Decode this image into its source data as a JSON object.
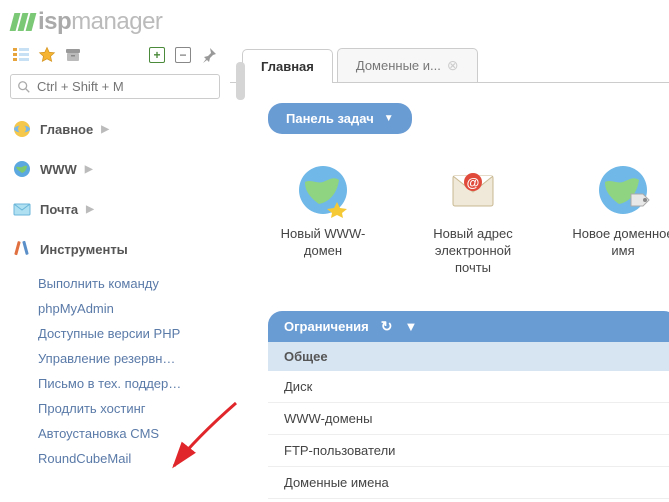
{
  "logo": {
    "bold": "isp",
    "light": "manager"
  },
  "search": {
    "placeholder": "Ctrl + Shift + M"
  },
  "nav": {
    "main": "Главное",
    "www": "WWW",
    "mail": "Почта",
    "tools": "Инструменты"
  },
  "tools_sub": [
    "Выполнить команду",
    "phpMyAdmin",
    "Доступные версии PHP",
    "Управление резервн…",
    "Письмо в тех. поддер…",
    "Продлить хостинг",
    "Автоустановка CMS",
    "RoundCubeMail"
  ],
  "tabs": [
    {
      "label": "Главная",
      "active": true
    },
    {
      "label": "Доменные и...",
      "active": false
    }
  ],
  "panel_button": "Панель задач",
  "tiles": [
    {
      "label": "Новый WWW-домен"
    },
    {
      "label": "Новый адрес электронной почты"
    },
    {
      "label": "Новое доменное имя"
    }
  ],
  "limits": {
    "title": "Ограничения",
    "sub": "Общее",
    "rows": [
      "Диск",
      "WWW-домены",
      "FTP-пользователи",
      "Доменные имена"
    ]
  }
}
